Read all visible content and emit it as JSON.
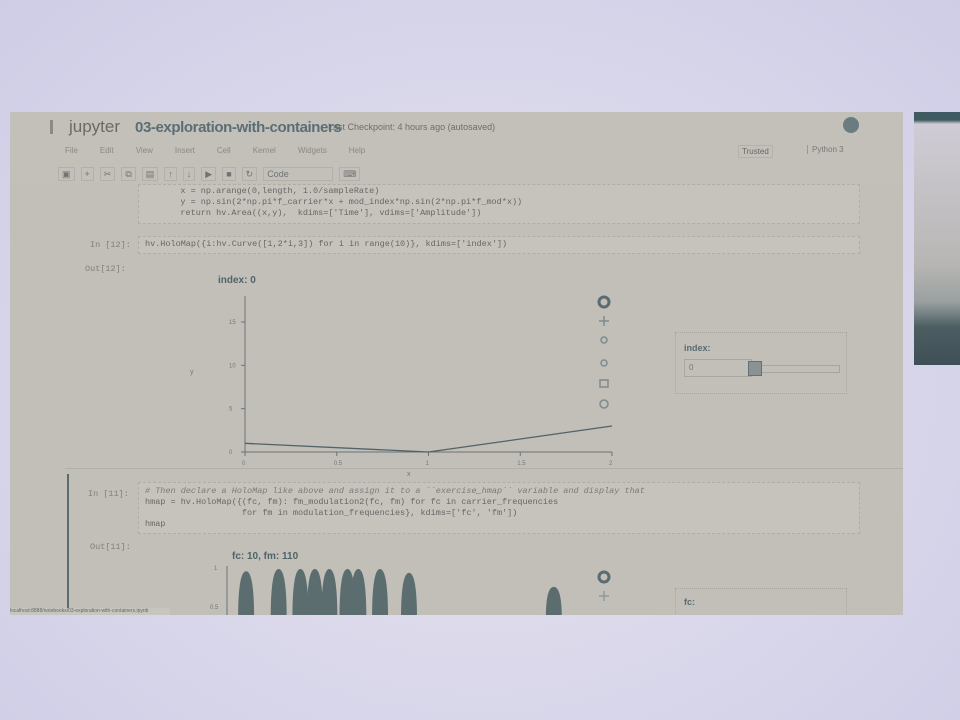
{
  "header": {
    "logo": "jupyter",
    "notebook_title": "03-exploration-with-containers",
    "checkpoint": "Last Checkpoint: 4 hours ago (autosaved)",
    "trusted": "Trusted",
    "kernel": "Python 3"
  },
  "menu": [
    "File",
    "Edit",
    "View",
    "Insert",
    "Cell",
    "Kernel",
    "Widgets",
    "Help"
  ],
  "toolbar": {
    "cell_type": "Code"
  },
  "cells": [
    {
      "code": [
        "    x = np.arange(0,length, 1.0/sampleRate)",
        "    y = np.sin(2*np.pi*f_carrier*x + mod_index*np.sin(2*np.pi*f_mod*x))",
        "    return hv.Area((x,y),  kdims=['Time'], vdims=['Amplitude'])"
      ]
    },
    {
      "in_prompt": "In [12]:",
      "code": [
        "hv.HoloMap({i:hv.Curve([1,2*i,3]) for i in range(10)}, kdims=['index'])"
      ],
      "out_prompt": "Out[12]:"
    },
    {
      "in_prompt": "In [11]:",
      "code": [
        "# Then declare a HoloMap like above and assign it to a ``exercise_hmap`` variable and display that",
        "hmap = hv.HoloMap({(fc, fm): fm_modulation2(fc, fm) for fc in carrier_frequencies",
        "                   for fm in modulation_frequencies}, kdims=['fc', 'fm'])",
        "hmap"
      ],
      "out_prompt": "Out[11]:"
    }
  ],
  "widget1": {
    "label": "index:",
    "value": "0",
    "slider_fraction": 0.0
  },
  "widget2": {
    "label": "fc:"
  },
  "status_url": "localhost:8888/notebooks/03-exploration-with-containers.ipynb",
  "chart_data": [
    {
      "type": "line",
      "title": "index: 0",
      "xlabel": "x",
      "ylabel": "y",
      "x": [
        0,
        1,
        2
      ],
      "y": [
        1,
        0,
        3
      ],
      "xlim": [
        0,
        2
      ],
      "ylim": [
        0,
        18
      ],
      "xticks": [
        "0",
        "0.5",
        "1",
        "1.5",
        "2"
      ],
      "yticks": [
        "0",
        "5",
        "10",
        "15"
      ],
      "color": "#4f6468"
    },
    {
      "type": "area",
      "title": "fc: 10, fm: 110",
      "ylim": [
        0.5,
        1
      ],
      "yticks": [
        "1",
        "0.5"
      ],
      "peaks_x": [
        0.05,
        0.14,
        0.2,
        0.24,
        0.28,
        0.33,
        0.36,
        0.42,
        0.5,
        0.9
      ],
      "peaks_y": [
        0.96,
        1,
        1,
        1,
        1,
        1,
        1,
        1,
        0.93,
        0.84
      ],
      "color": "#5c6d70"
    }
  ]
}
